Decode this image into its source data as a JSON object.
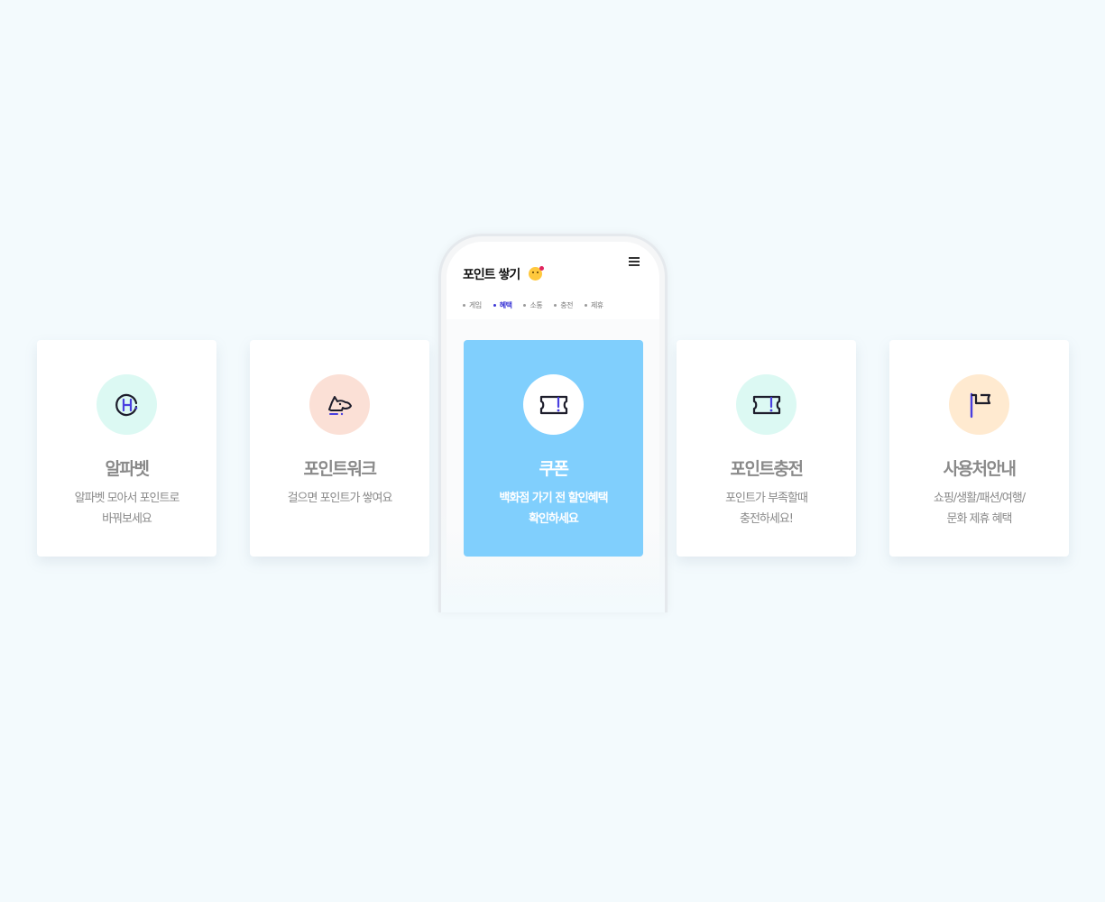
{
  "phone": {
    "title": "포인트 쌓기",
    "emoji_icon": "kissing-face-icon",
    "menu_icon": "hamburger-menu-icon",
    "tabs": [
      {
        "label": "게임",
        "active": false
      },
      {
        "label": "혜택",
        "active": true
      },
      {
        "label": "소통",
        "active": false
      },
      {
        "label": "충전",
        "active": false
      },
      {
        "label": "제휴",
        "active": false
      }
    ]
  },
  "cards": [
    {
      "title": "알파벳",
      "desc_line1": "알파벳 모아서 포인트로",
      "desc_line2": "바꿔보세요",
      "icon": "alphabet-h-icon",
      "icon_bg": "#dcf9f3"
    },
    {
      "title": "포인트워크",
      "desc_line1": "걸으면 포인트가 쌓여요",
      "desc_line2": "",
      "icon": "dog-walk-icon",
      "icon_bg": "#fbe0d6"
    },
    {
      "title": "쿠폰",
      "desc_line1": "백화점 가기 전 할인혜택",
      "desc_line2": "확인하세요",
      "icon": "coupon-ticket-icon",
      "icon_bg": "#ffffff",
      "card_bg": "#80cffd"
    },
    {
      "title": "포인트충전",
      "desc_line1": "포인트가 부족할때",
      "desc_line2": "충전하세요!",
      "icon": "charge-ticket-icon",
      "icon_bg": "#dcf9f3"
    },
    {
      "title": "사용처안내",
      "desc_line1": "쇼핑/생활/패션/여행/",
      "desc_line2": "문화 제휴 혜택",
      "icon": "flag-icon",
      "icon_bg": "#ffead0"
    }
  ],
  "colors": {
    "page_bg": "#f3fafd",
    "accent": "#3b36d6",
    "featured_card": "#80cffd",
    "text_gray": "#8a8a8a"
  }
}
